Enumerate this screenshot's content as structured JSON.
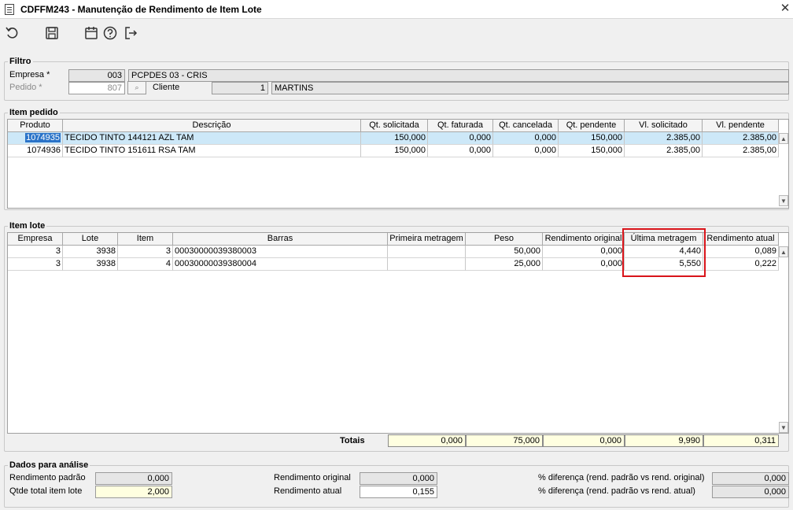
{
  "window": {
    "title": "CDFFM243 - Manutenção de Rendimento de Item Lote",
    "close": "✕"
  },
  "toolbar": {
    "icons": [
      "undo-icon",
      "save-icon",
      "calendar-icon",
      "help-icon",
      "exit-icon"
    ]
  },
  "filtro": {
    "title": "Filtro",
    "empresa_label": "Empresa *",
    "empresa_code": "003",
    "empresa_name": "PCPDES 03 - CRIS",
    "pedido_label": "Pedido *",
    "pedido_value": "807",
    "cliente_label": "Cliente",
    "cliente_code": "1",
    "cliente_name": "MARTINS"
  },
  "item_pedido": {
    "title": "Item pedido",
    "columns": [
      "Produto",
      "Descrição",
      "Qt. solicitada",
      "Qt. faturada",
      "Qt. cancelada",
      "Qt. pendente",
      "Vl. solicitado",
      "Vl. pendente"
    ],
    "rows": [
      [
        "1074935",
        "TECIDO TINTO 144121 AZL TAM",
        "150,000",
        "0,000",
        "0,000",
        "150,000",
        "2.385,00",
        "2.385,00"
      ],
      [
        "1074936",
        "TECIDO TINTO 151611 RSA TAM",
        "150,000",
        "0,000",
        "0,000",
        "150,000",
        "2.385,00",
        "2.385,00"
      ]
    ]
  },
  "item_lote": {
    "title": "Item lote",
    "columns": [
      "Empresa",
      "Lote",
      "Item",
      "Barras",
      "Primeira metragem",
      "Peso",
      "Rendimento original",
      "Última metragem",
      "Rendimento atual"
    ],
    "rows": [
      [
        "3",
        "3938",
        "3",
        "00030000039380003",
        "",
        "50,000",
        "0,000",
        "4,440",
        "0,089"
      ],
      [
        "3",
        "3938",
        "4",
        "00030000039380004",
        "",
        "25,000",
        "0,000",
        "5,550",
        "0,222"
      ]
    ],
    "totals_label": "Totais",
    "totals": [
      "0,000",
      "75,000",
      "0,000",
      "9,990",
      "0,311"
    ]
  },
  "analise": {
    "title": "Dados para análise",
    "rend_padrao_label": "Rendimento padrão",
    "rend_padrao": "0,000",
    "qtde_total_label": "Qtde total item lote",
    "qtde_total": "2,000",
    "rend_original_label": "Rendimento original",
    "rend_original": "0,000",
    "rend_atual_label": "Rendimento atual",
    "rend_atual": "0,155",
    "dif_original_label": "% diferença (rend. padrão vs rend. original)",
    "dif_original": "0,000",
    "dif_atual_label": "% diferença (rend. padrão vs rend. atual)",
    "dif_atual": "0,000"
  },
  "colors": {
    "highlight": "#d9141a",
    "selected_row": "#cde8f8",
    "focus_cell": "#2a73c8",
    "yellow_field": "#ffffe0"
  }
}
